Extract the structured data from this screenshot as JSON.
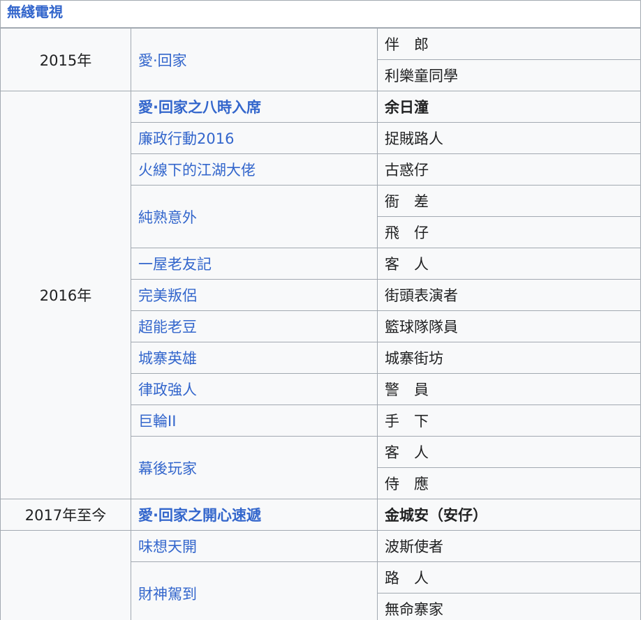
{
  "section_header": "無綫電視",
  "rows": [
    {
      "year": "2015年",
      "title": "愛·回家",
      "role": "伴　郎"
    },
    {
      "role": "利樂童同學"
    },
    {
      "year": "2016年",
      "title": "愛·回家之八時入席",
      "role": "余日潼"
    },
    {
      "title": "廉政行動2016",
      "role": "捉賊路人"
    },
    {
      "title": "火線下的江湖大佬",
      "role": "古惑仔"
    },
    {
      "title": "純熟意外",
      "role": "衙　差"
    },
    {
      "role": "飛　仔"
    },
    {
      "title": "一屋老友記",
      "role": "客　人"
    },
    {
      "title": "完美叛侶",
      "role": "街頭表演者"
    },
    {
      "title": "超能老豆",
      "role": "籃球隊隊員"
    },
    {
      "title": "城寨英雄",
      "role": "城寨街坊"
    },
    {
      "title": "律政強人",
      "role": "警　員"
    },
    {
      "title": "巨輪II",
      "role": "手　下"
    },
    {
      "title": "幕後玩家",
      "role": "客　人"
    },
    {
      "role": "侍　應"
    },
    {
      "year": "2017年至今",
      "title": "愛·回家之開心速遞",
      "role": "金城安（安仔）"
    },
    {
      "title": "味想天開",
      "role": "波斯使者"
    },
    {
      "title": "財神駕到",
      "role": "路　人"
    },
    {
      "role": "無命寨家"
    }
  ]
}
